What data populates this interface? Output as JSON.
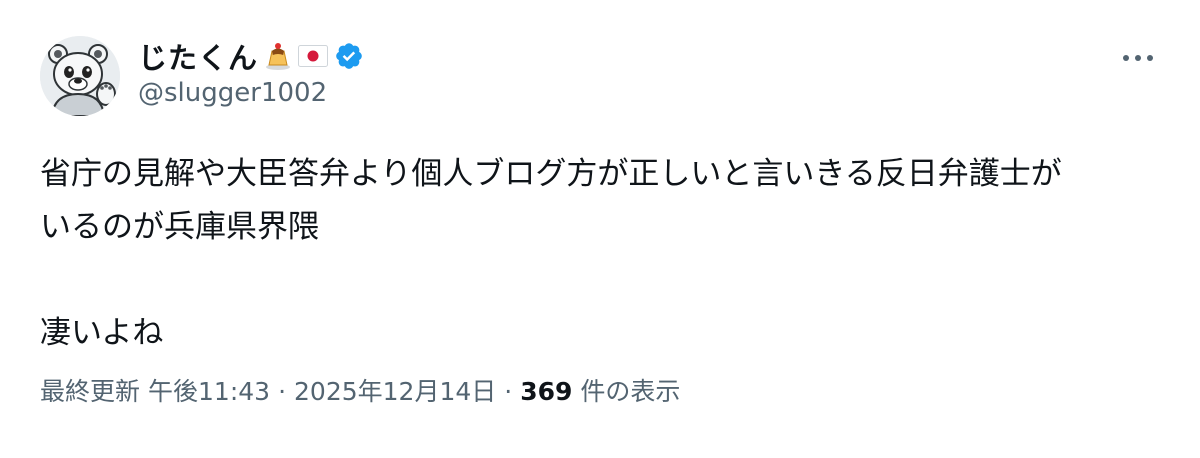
{
  "author": {
    "display_name": "じたくん",
    "handle": "@slugger1002",
    "avatar_icon": "polar-bear-avatar-icon",
    "name_emojis": [
      "pudding-emoji-icon",
      "japan-flag-icon"
    ],
    "verified_icon": "verified-badge-icon",
    "verified_color": "#1d9bf0"
  },
  "more_icon": "more-options-icon",
  "tweet": {
    "line1": "省庁の見解や大臣答弁より個人ブログ方が正しいと言いきる反日弁護士が",
    "line2": "いるのが兵庫県界隈",
    "line3": "凄いよね"
  },
  "meta": {
    "last_updated_label": "最終更新",
    "time": "午後11:43",
    "separator": "·",
    "date": "2025年12月14日",
    "views_count": "369",
    "views_label": "件の表示"
  },
  "colors": {
    "text_primary": "#0f1419",
    "text_secondary": "#536471",
    "background": "#ffffff"
  }
}
